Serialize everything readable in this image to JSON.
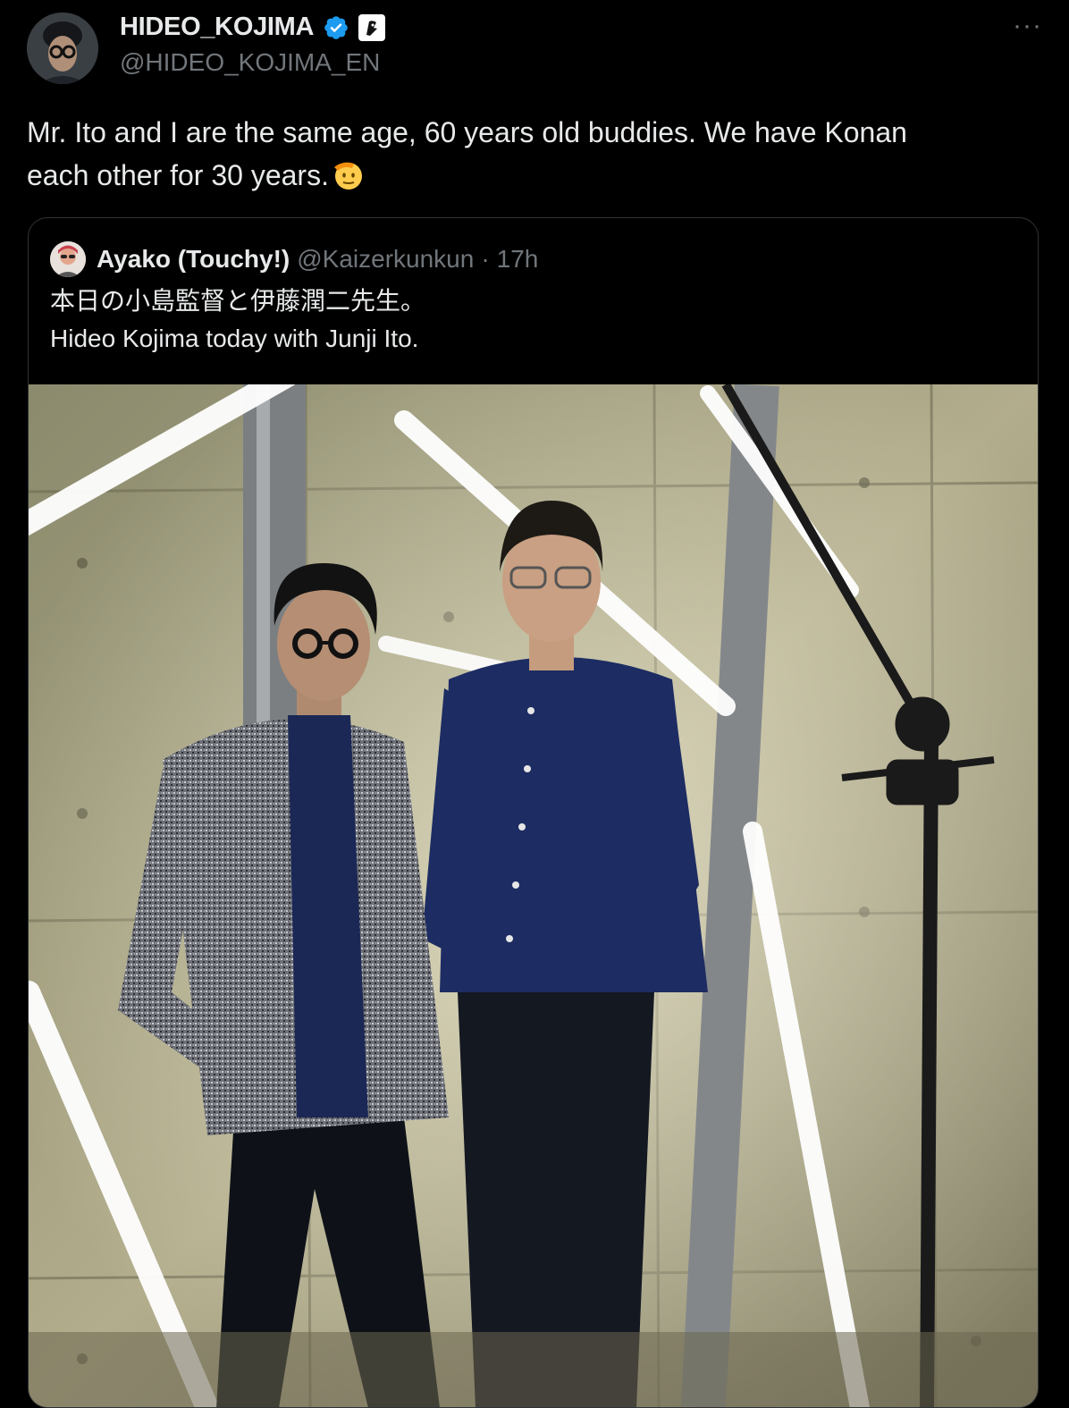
{
  "author": {
    "name": "HIDEO_KOJIMA",
    "handle": "@HIDEO_KOJIMA_EN"
  },
  "tweet": {
    "line1": "Mr. Ito and I are the same age, 60 years old buddies. We have Konan",
    "line2": "each other for 30 years."
  },
  "menu": {
    "more_label": "···"
  },
  "quoted": {
    "name": "Ayako (Touchy!)",
    "handle": "@Kaizerkunkun",
    "separator": "·",
    "time": "17h",
    "line1": "本日の小島監督と伊藤潤二先生。",
    "line2": "Hideo Kojima today with Junji Ito."
  },
  "icons": {
    "verified": "verified-badge-icon",
    "affiliate": "affiliate-badge-icon",
    "emoji": "saluting-face-emoji",
    "more": "more-options-icon"
  },
  "colors": {
    "background": "#000000",
    "text": "#e7e9ea",
    "muted": "#71767b",
    "border": "#2f3336",
    "verified": "#1d9bf0"
  }
}
